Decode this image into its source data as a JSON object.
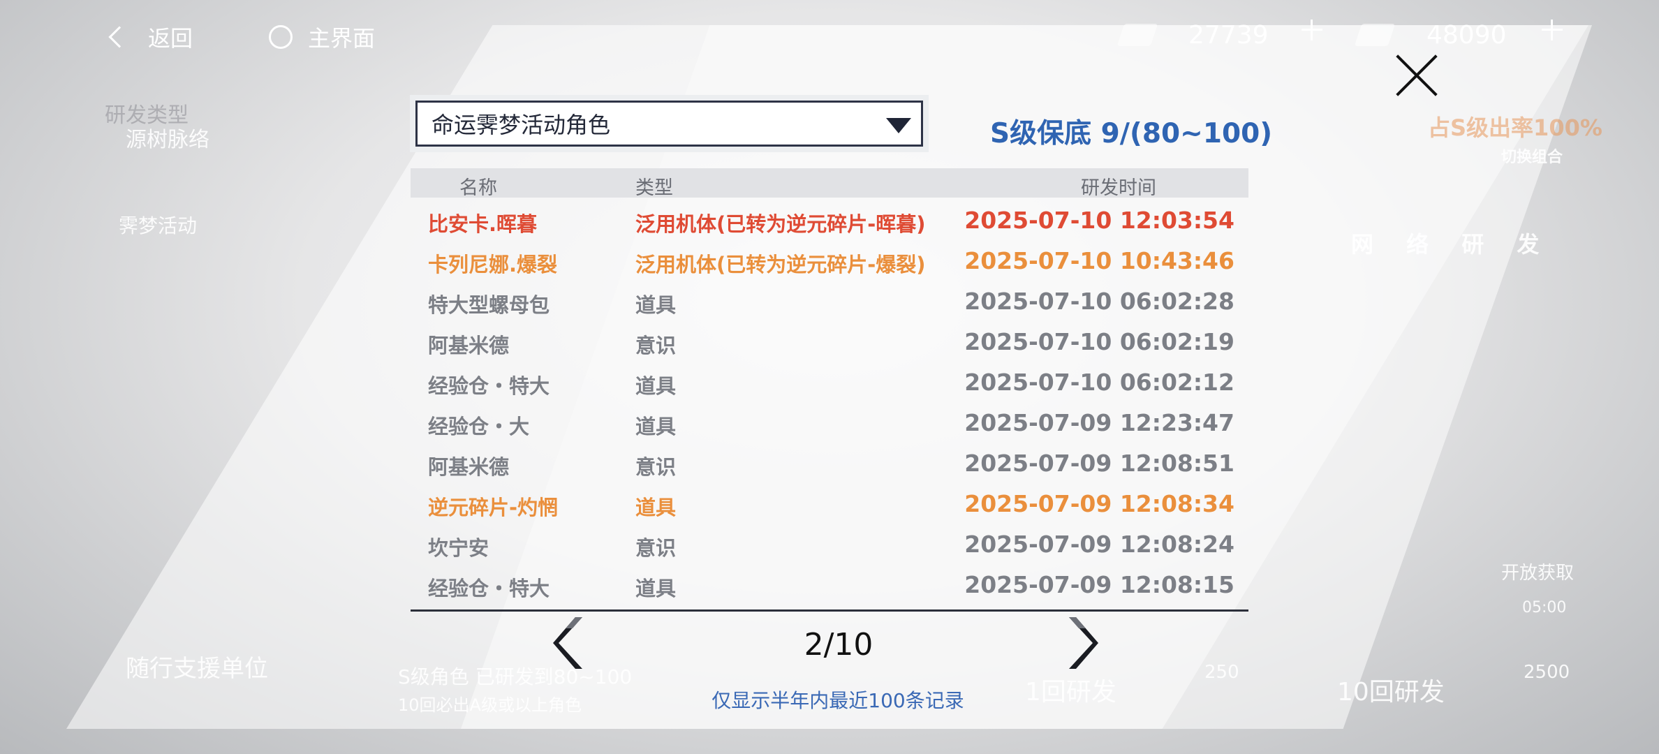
{
  "colors": {
    "accent_blue": "#2f64b2",
    "s_rank_red": "#df4b34",
    "a_rank_orange": "#ea8f3c",
    "normal_gray": "#7c7f86"
  },
  "topbar": {
    "back_label": "返回",
    "home_label": "主界面",
    "resource1": {
      "icon": "craft-card-icon",
      "value": "27739"
    },
    "resource2": {
      "icon": "black-card-icon",
      "value": "48090"
    }
  },
  "background": {
    "research_type": "研发类型",
    "source_tab": "源树脉络",
    "event_tab": "霁梦活动",
    "switch_combo": "切换组合",
    "s_rate": "占S级出率100%",
    "network_research": "网 络 研 发",
    "support_unit": "随行支援单位",
    "bottom_note1": "S级角色  已研发到80~100",
    "bottom_note2": "10回必出A级或以上角色",
    "single_draw": "1回研发",
    "single_cost": "250",
    "ten_draw": "10回研发",
    "ten_cost": "2500",
    "open_get": "开放获取",
    "countdown": "05:00"
  },
  "dialog": {
    "pool_selected": "命运霁梦活动角色",
    "pity": "S级保底 9/(80~100)",
    "headers": {
      "name": "名称",
      "type": "类型",
      "time": "研发时间"
    },
    "records": [
      {
        "name": "比安卡.晖暮",
        "type": "泛用机体(已转为逆元碎片-晖暮)",
        "time": "2025-07-10 12:03:54",
        "rarity": "red"
      },
      {
        "name": "卡列尼娜.爆裂",
        "type": "泛用机体(已转为逆元碎片-爆裂)",
        "time": "2025-07-10 10:43:46",
        "rarity": "orange"
      },
      {
        "name": "特大型螺母包",
        "type": "道具",
        "time": "2025-07-10 06:02:28",
        "rarity": "gray"
      },
      {
        "name": "阿基米德",
        "type": "意识",
        "time": "2025-07-10 06:02:19",
        "rarity": "gray"
      },
      {
        "name": "经验仓・特大",
        "type": "道具",
        "time": "2025-07-10 06:02:12",
        "rarity": "gray"
      },
      {
        "name": "经验仓・大",
        "type": "道具",
        "time": "2025-07-09 12:23:47",
        "rarity": "gray"
      },
      {
        "name": "阿基米德",
        "type": "意识",
        "time": "2025-07-09 12:08:51",
        "rarity": "gray"
      },
      {
        "name": "逆元碎片-灼惘",
        "type": "道具",
        "time": "2025-07-09 12:08:34",
        "rarity": "orange"
      },
      {
        "name": "坎宁安",
        "type": "意识",
        "time": "2025-07-09 12:08:24",
        "rarity": "gray"
      },
      {
        "name": "经验仓・特大",
        "type": "道具",
        "time": "2025-07-09 12:08:15",
        "rarity": "gray"
      }
    ],
    "page_current": 2,
    "page_total": 10,
    "page_indicator": "2/10",
    "footnote": "仅显示半年内最近100条记录"
  }
}
